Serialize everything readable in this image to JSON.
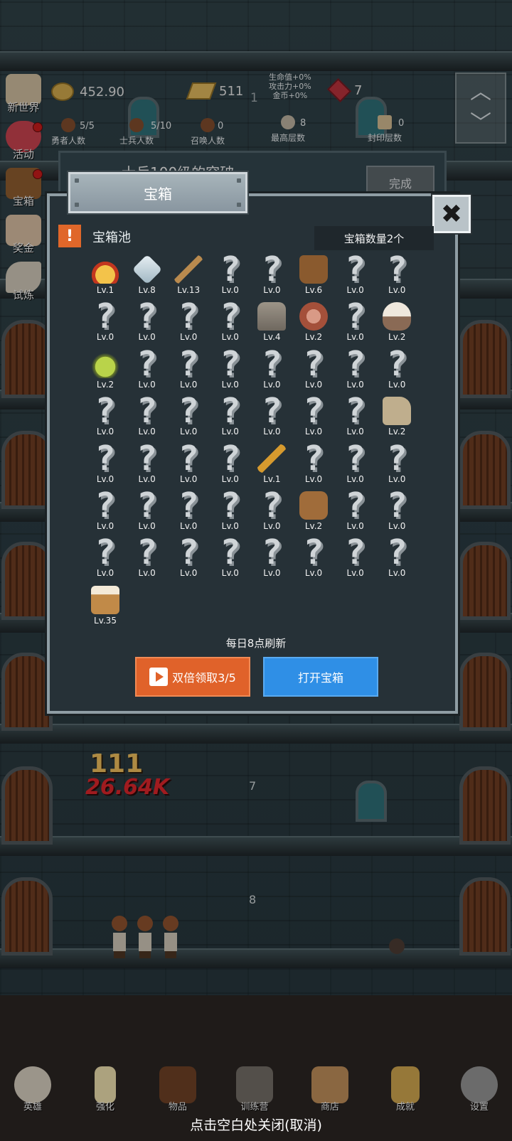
{
  "hud": {
    "coins": "452.90",
    "gold": "511",
    "ruby": "7",
    "center_floor": "1",
    "bonus": [
      "生命值+0%",
      "攻击力+0%",
      "金币+0%"
    ],
    "stats": [
      {
        "label": "勇者人数",
        "value": "5/5"
      },
      {
        "label": "士兵人数",
        "value": "5/10"
      },
      {
        "label": "召唤人数",
        "value": "0"
      },
      {
        "label": "最高层数",
        "value": "8"
      },
      {
        "label": "封印层数",
        "value": "0"
      }
    ]
  },
  "side_menu": [
    "新世界",
    "活动",
    "宝箱",
    "奖金",
    "试炼"
  ],
  "quest": {
    "text": "士兵100级的突破",
    "button": "完成"
  },
  "modal": {
    "title": "宝箱",
    "pool_icon": "!",
    "pool_label": "宝箱池",
    "count": "宝箱数量2个",
    "refresh_note": "每日8点刷新",
    "double_button": "双倍领取3/5",
    "open_button": "打开宝箱",
    "close_icon": "✖"
  },
  "chest_items": [
    {
      "icon": "crown",
      "lv": "Lv.1"
    },
    {
      "icon": "diamond",
      "lv": "Lv.8"
    },
    {
      "icon": "sword",
      "lv": "Lv.13"
    },
    {
      "icon": "unknown",
      "lv": "Lv.0"
    },
    {
      "icon": "unknown",
      "lv": "Lv.0"
    },
    {
      "icon": "armor",
      "lv": "Lv.6"
    },
    {
      "icon": "unknown",
      "lv": "Lv.0"
    },
    {
      "icon": "unknown",
      "lv": "Lv.0"
    },
    {
      "icon": "unknown",
      "lv": "Lv.0"
    },
    {
      "icon": "unknown",
      "lv": "Lv.0"
    },
    {
      "icon": "unknown",
      "lv": "Lv.0"
    },
    {
      "icon": "unknown",
      "lv": "Lv.0"
    },
    {
      "icon": "helmet",
      "lv": "Lv.4"
    },
    {
      "icon": "meat",
      "lv": "Lv.2"
    },
    {
      "icon": "unknown",
      "lv": "Lv.0"
    },
    {
      "icon": "bowl",
      "lv": "Lv.2"
    },
    {
      "icon": "potion",
      "lv": "Lv.2"
    },
    {
      "icon": "unknown",
      "lv": "Lv.0"
    },
    {
      "icon": "unknown",
      "lv": "Lv.0"
    },
    {
      "icon": "unknown",
      "lv": "Lv.0"
    },
    {
      "icon": "unknown",
      "lv": "Lv.0"
    },
    {
      "icon": "unknown",
      "lv": "Lv.0"
    },
    {
      "icon": "unknown",
      "lv": "Lv.0"
    },
    {
      "icon": "unknown",
      "lv": "Lv.0"
    },
    {
      "icon": "unknown",
      "lv": "Lv.0"
    },
    {
      "icon": "unknown",
      "lv": "Lv.0"
    },
    {
      "icon": "unknown",
      "lv": "Lv.0"
    },
    {
      "icon": "unknown",
      "lv": "Lv.0"
    },
    {
      "icon": "unknown",
      "lv": "Lv.0"
    },
    {
      "icon": "unknown",
      "lv": "Lv.0"
    },
    {
      "icon": "unknown",
      "lv": "Lv.0"
    },
    {
      "icon": "boots",
      "lv": "Lv.2"
    },
    {
      "icon": "unknown",
      "lv": "Lv.0"
    },
    {
      "icon": "unknown",
      "lv": "Lv.0"
    },
    {
      "icon": "unknown",
      "lv": "Lv.0"
    },
    {
      "icon": "unknown",
      "lv": "Lv.0"
    },
    {
      "icon": "torch",
      "lv": "Lv.1"
    },
    {
      "icon": "unknown",
      "lv": "Lv.0"
    },
    {
      "icon": "unknown",
      "lv": "Lv.0"
    },
    {
      "icon": "unknown",
      "lv": "Lv.0"
    },
    {
      "icon": "unknown",
      "lv": "Lv.0"
    },
    {
      "icon": "unknown",
      "lv": "Lv.0"
    },
    {
      "icon": "unknown",
      "lv": "Lv.0"
    },
    {
      "icon": "unknown",
      "lv": "Lv.0"
    },
    {
      "icon": "unknown",
      "lv": "Lv.0"
    },
    {
      "icon": "backpack",
      "lv": "Lv.2"
    },
    {
      "icon": "unknown",
      "lv": "Lv.0"
    },
    {
      "icon": "unknown",
      "lv": "Lv.0"
    },
    {
      "icon": "unknown",
      "lv": "Lv.0"
    },
    {
      "icon": "unknown",
      "lv": "Lv.0"
    },
    {
      "icon": "unknown",
      "lv": "Lv.0"
    },
    {
      "icon": "unknown",
      "lv": "Lv.0"
    },
    {
      "icon": "unknown",
      "lv": "Lv.0"
    },
    {
      "icon": "unknown",
      "lv": "Lv.0"
    },
    {
      "icon": "unknown",
      "lv": "Lv.0"
    },
    {
      "icon": "unknown",
      "lv": "Lv.0"
    },
    {
      "icon": "beer",
      "lv": "Lv.35"
    }
  ],
  "floors": [
    "7",
    "8"
  ],
  "damage": {
    "hits": "111",
    "total": "26.64K"
  },
  "nav": [
    "英雄",
    "强化",
    "物品",
    "训练营",
    "商店",
    "成就",
    "设置"
  ],
  "close_tip": "点击空白处关闭(取消)",
  "colors": {
    "accent_orange": "#e0622a",
    "accent_blue": "#2f8fe6",
    "panel": "#263137"
  }
}
